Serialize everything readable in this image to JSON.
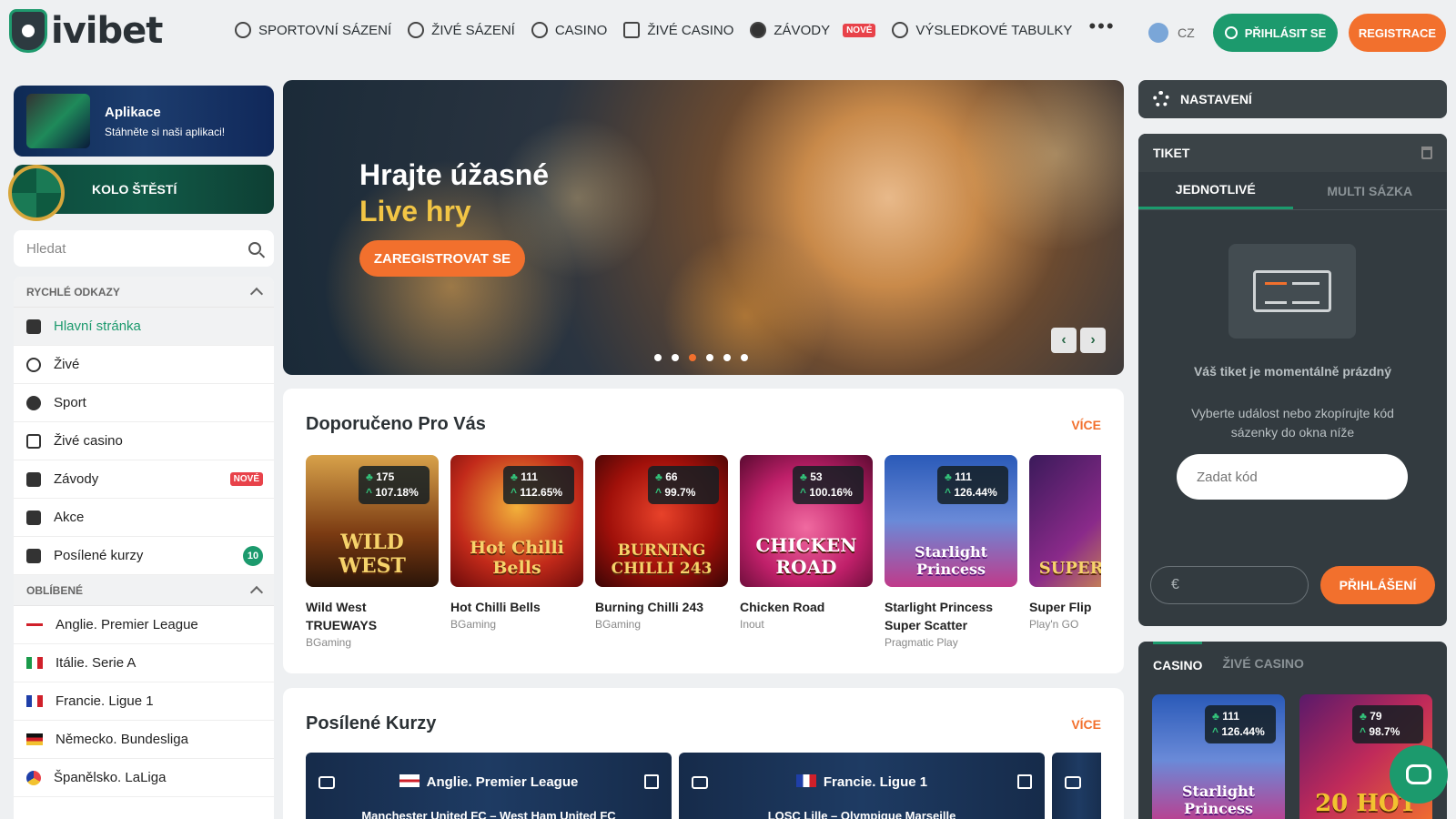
{
  "brand": {
    "name": "ivibet"
  },
  "nav": {
    "items": [
      {
        "label": "SPORTOVNÍ SÁZENÍ",
        "icon": "soccer-ball-icon"
      },
      {
        "label": "ŽIVÉ SÁZENÍ",
        "icon": "stopwatch-icon"
      },
      {
        "label": "CASINO",
        "icon": "roulette-icon"
      },
      {
        "label": "ŽIVÉ CASINO",
        "icon": "cards-icon"
      },
      {
        "label": "ZÁVODY",
        "icon": "horse-icon",
        "badge": "NOVÉ"
      },
      {
        "label": "VÝSLEDKOVÉ TABULKY",
        "icon": "laurel-icon"
      }
    ],
    "more": "•••",
    "lang": "CZ",
    "login": "PŘIHLÁSIT SE",
    "register": "REGISTRACE"
  },
  "promo": {
    "app_title": "Aplikace",
    "app_sub": "Stáhněte si naši aplikaci!",
    "wheel_label": "KOLO ŠTĚSTÍ"
  },
  "search": {
    "placeholder": "Hledat"
  },
  "sidebar": {
    "quick_title": "RYCHLÉ ODKAZY",
    "quick": [
      {
        "label": "Hlavní stránka"
      },
      {
        "label": "Živé"
      },
      {
        "label": "Sport"
      },
      {
        "label": "Živé casino"
      },
      {
        "label": "Závody",
        "badge": "NOVÉ"
      },
      {
        "label": "Akce"
      },
      {
        "label": "Posílené kurzy",
        "count": "10"
      }
    ],
    "fav_title": "OBLÍBENÉ",
    "fav": [
      {
        "label": "Anglie. Premier League"
      },
      {
        "label": "Itálie. Serie A"
      },
      {
        "label": "Francie. Ligue 1"
      },
      {
        "label": "Německo. Bundesliga"
      },
      {
        "label": "Španělsko. LaLiga"
      }
    ]
  },
  "banner": {
    "line1": "Hrajte úžasné",
    "line2": "Live hry",
    "cta": "ZAREGISTROVAT SE",
    "slides": 6,
    "active_slide": 2
  },
  "recommended": {
    "title": "Doporučeno Pro Vás",
    "more": "VÍCE",
    "games": [
      {
        "name": "Wild West TRUEWAYS",
        "provider": "BGaming",
        "players": "175",
        "rtp": "107.18%",
        "art": "WILD WEST"
      },
      {
        "name": "Hot Chilli Bells",
        "provider": "BGaming",
        "players": "111",
        "rtp": "112.65%",
        "art": "Hot Chilli Bells"
      },
      {
        "name": "Burning Chilli 243",
        "provider": "BGaming",
        "players": "66",
        "rtp": "99.7%",
        "art": "BURNING CHILLI 243"
      },
      {
        "name": "Chicken Road",
        "provider": "Inout",
        "players": "53",
        "rtp": "100.16%",
        "art": "CHICKEN ROAD"
      },
      {
        "name": "Starlight Princess Super Scatter",
        "provider": "Pragmatic Play",
        "players": "111",
        "rtp": "126.44%",
        "art": "Starlight Princess"
      },
      {
        "name": "Super Flip",
        "provider": "Play'n GO",
        "players": "",
        "rtp": "",
        "art": "SUPER FLIP"
      }
    ]
  },
  "boosted": {
    "title": "Posílené Kurzy",
    "more": "VÍCE",
    "matches": [
      {
        "league": "Anglie. Premier League",
        "teams": "Manchester United FC – West Ham United FC"
      },
      {
        "league": "Francie. Ligue 1",
        "teams": "LOSC Lille – Olympique Marseille"
      }
    ]
  },
  "settings": {
    "label": "NASTAVENÍ"
  },
  "ticket": {
    "title": "TIKET",
    "tab_single": "JEDNOTLIVÉ",
    "tab_multi": "MULTI SÁZKA",
    "empty": "Váš tiket je momentálně prázdný",
    "hint": "Vyberte událost nebo zkopírujte kód sázenky do okna níže",
    "code_placeholder": "Zadat kód",
    "currency": "€",
    "submit": "PŘIHLÁŠENÍ"
  },
  "casino_widget": {
    "tab_casino": "CASINO",
    "tab_live": "ŽIVÉ CASINO",
    "games": [
      {
        "players": "111",
        "rtp": "126.44%",
        "art": "Starlight Princess"
      },
      {
        "players": "79",
        "rtp": "98.7%",
        "art": "20 HOT"
      }
    ]
  },
  "colors": {
    "accent": "#1c9a6d",
    "cta": "#f2702d",
    "badge": "#e8424a",
    "panel_dark": "#333b40"
  }
}
